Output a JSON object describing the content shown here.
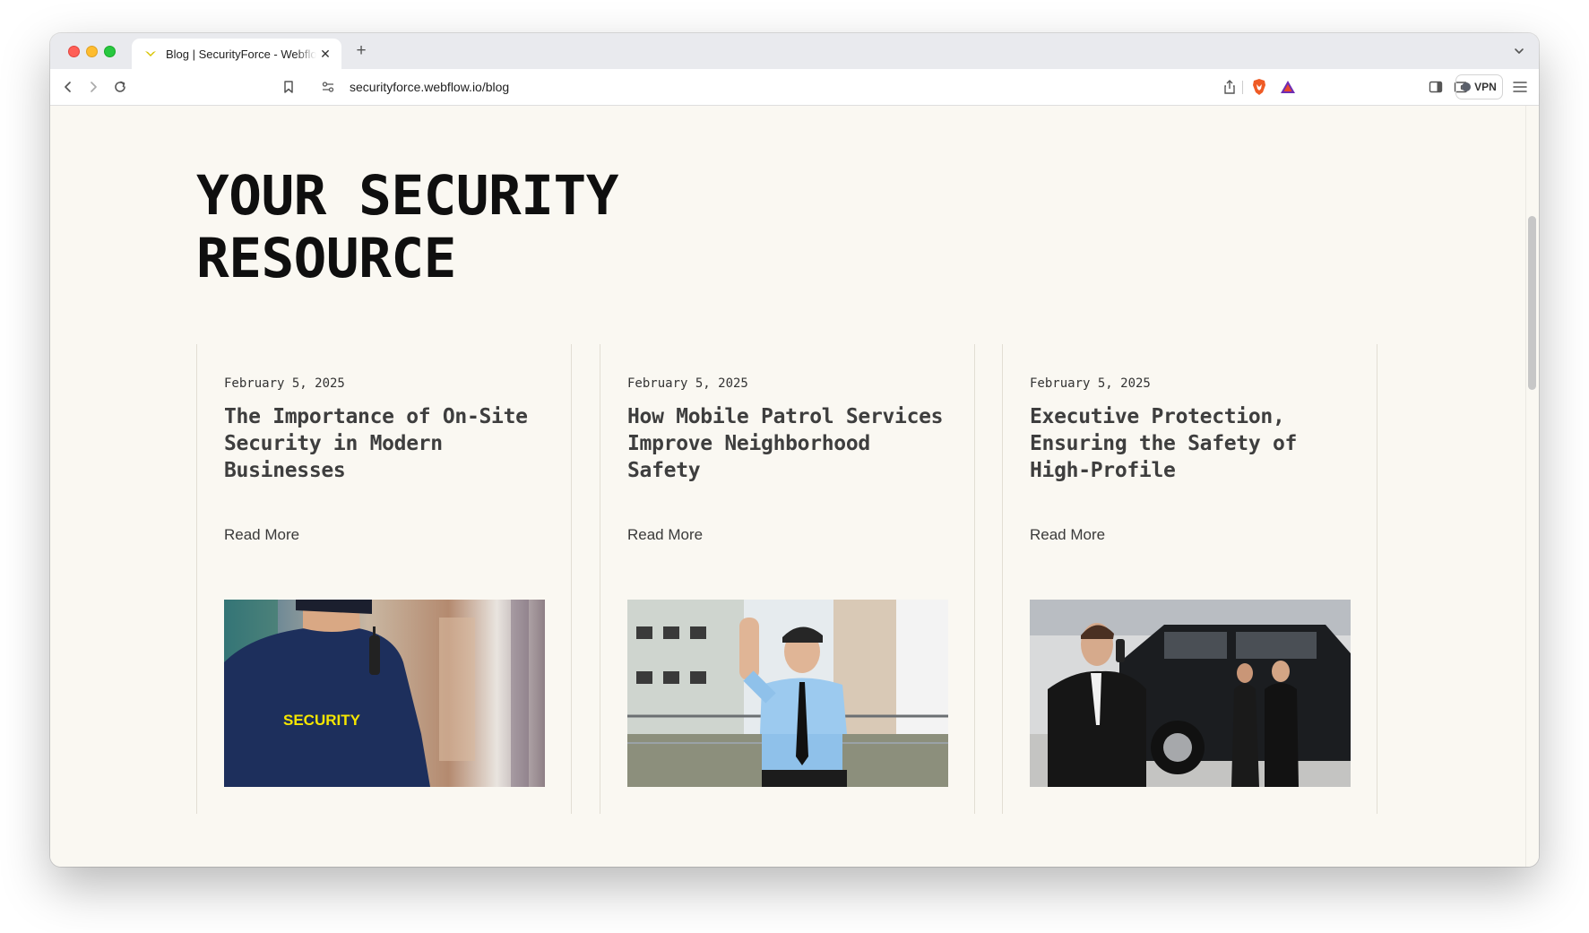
{
  "browser": {
    "tab_title": "Blog | SecurityForce - Webflow Template",
    "new_tab_symbol": "+",
    "close_symbol": "✕",
    "url": "securityforce.webflow.io/blog",
    "vpn_label": "VPN"
  },
  "page": {
    "heading_line1": "YOUR SECURITY",
    "heading_line2": "RESOURCE"
  },
  "posts": [
    {
      "date": "February 5, 2025",
      "title": "The Importance of On-Site Security in Modern Businesses",
      "link_label": "Read More",
      "jacket_text": "SECURITY"
    },
    {
      "date": "February 5, 2025",
      "title": "How Mobile Patrol Services Improve Neighborhood Safety",
      "link_label": "Read More"
    },
    {
      "date": "February 5, 2025",
      "title": "Executive Protection, Ensuring the Safety of High-Profile",
      "link_label": "Read More"
    }
  ],
  "colors": {
    "page_background": "#faf8f2",
    "heading": "#0f0f0f",
    "card_title": "#3e3e3e",
    "card_border": "#e2ded4",
    "jacket_text": "#f5e600"
  }
}
